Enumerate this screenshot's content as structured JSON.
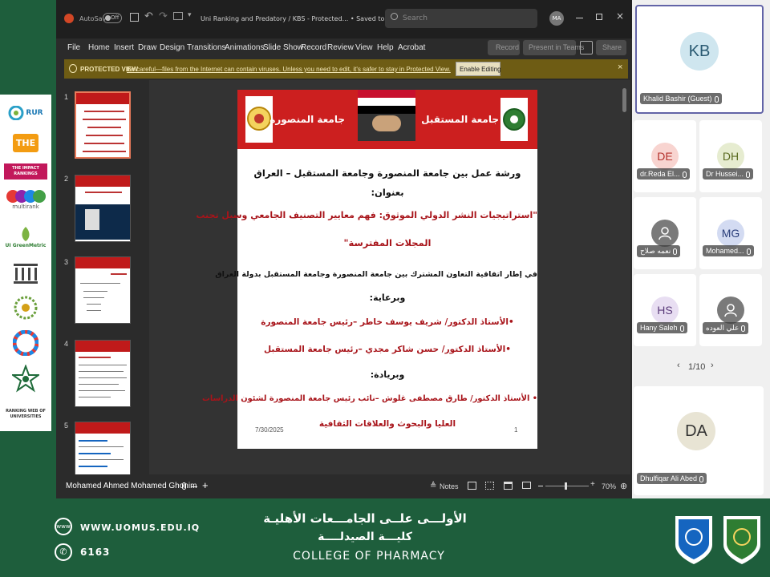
{
  "window": {
    "autosave_label": "AutoSave",
    "autosave_state": "Off",
    "title": "Uni Ranking and Predatory / KBS - Protected... • Saved to this PC",
    "search_placeholder": "Search",
    "user_initials": "MA"
  },
  "menu": [
    "File",
    "Home",
    "Insert",
    "Draw",
    "Design",
    "Transitions",
    "Animations",
    "Slide Show",
    "Record",
    "Review",
    "View",
    "Help",
    "Acrobat"
  ],
  "ribbon_right": {
    "record": "Record",
    "present": "Present in Teams",
    "share": "Share"
  },
  "protected_view": {
    "label": "PROTECTED VIEW",
    "message": "Be careful—files from the Internet can contain viruses. Unless you need to edit, it's safer to stay in Protected View.",
    "button": "Enable Editing"
  },
  "thumbnails": [
    "1",
    "2",
    "3",
    "4",
    "5"
  ],
  "slide": {
    "header_left": "جامعة المستقبل",
    "header_right": "جامعة المنصورة",
    "line1": "ورشة عمل بين جامعة المنصورة وجامعة المستقبل – العراق",
    "line2": "بعنوان:",
    "title_line1": "\"استراتيجيات النشر الدولي الموثوق: فهم معايير التصنيف الجامعي وسبل تجنب",
    "title_line2": "المجلات المفترسة\"",
    "context": "في إطار اتفاقية التعاون المشترك بين جامعة المنصورة وجامعة المستقبل بدولة العراق",
    "patronage_label": "وبرعاية:",
    "patron1": "•الأستاذ الدكتور/ شريف يوسف خاطر –رئيس جامعة المنصورة",
    "patron2": "•الأستاذ الدكتور/ حسن شاكر مجدي –رئيس جامعة المستقبل",
    "leadership_label": "وبريادة:",
    "leader_line1": "•  الأستاذ الدكتور/ طارق مصطفى غلوش –نائب رئيس جامعة المنصورة لشئون الدراسات",
    "leader_line2": "العليا والبحوث والعلاقات الثقافية",
    "date": "7/30/2025",
    "page": "1"
  },
  "status": {
    "presenter": "Mohamed Ahmed Mohamed Ghonim",
    "notes": "Notes",
    "zoom": "70%"
  },
  "participants": {
    "main": {
      "initials": "KB",
      "name": "Khalid Bashir (Guest)"
    },
    "tiles": [
      {
        "initials": "DE",
        "name": "dr.Reda El..."
      },
      {
        "initials": "DH",
        "name": "Dr Hussei..."
      },
      {
        "initials": "",
        "name": "نعمه صلاح"
      },
      {
        "initials": "MG",
        "name": "Mohamed..."
      },
      {
        "initials": "HS",
        "name": "Hany Saleh"
      },
      {
        "initials": "",
        "name": "علي العوده"
      }
    ],
    "pager": "1/10",
    "bottom": {
      "initials": "DA",
      "name": "Dhulfiqar Ali Abed"
    }
  },
  "rankings": {
    "rur": "RUR",
    "the": "THE",
    "the_impact": "THE IMPACT RANKINGS",
    "multirank": "multirank",
    "greenmetric": "UI GreenMetric",
    "webometrics": "RANKING WEB OF UNIVERSITIES"
  },
  "footer": {
    "website": "WWW.UOMUS.EDU.IQ",
    "phone": "6163",
    "arabic_title": "الأولـــى علــى الجامـــعات الأهليـة",
    "arabic_college": "كليـــة الصيدلــــة",
    "english_college": "COLLEGE OF PHARMACY"
  },
  "colors": {
    "frame_green": "#1e5e3c",
    "slide_red": "#cc1f1f",
    "protected_bar": "#6e5c14",
    "slide_text_red": "#a8141a"
  }
}
